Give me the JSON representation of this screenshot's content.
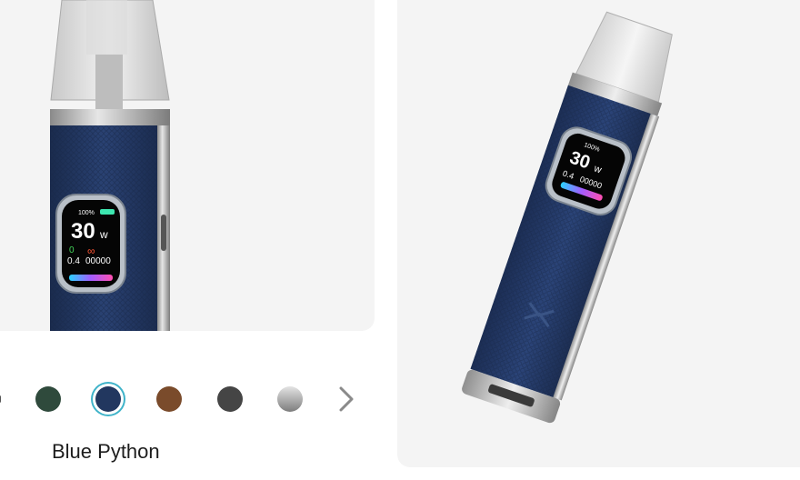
{
  "product": {
    "selected_color_name": "Blue Python"
  },
  "color_swatches": [
    {
      "name": "Green",
      "color": "#2f4a3c",
      "selected": false
    },
    {
      "name": "Blue Python",
      "color": "#22375f",
      "selected": true
    },
    {
      "name": "Brown",
      "color": "#7a4b2b",
      "selected": false
    },
    {
      "name": "Black",
      "color": "#454545",
      "selected": false
    },
    {
      "name": "Silver",
      "color": "#9a9a9a",
      "selected": false
    }
  ],
  "device_screen": {
    "battery": "100%",
    "wattage": "30",
    "wattage_unit": "w",
    "resistance_top": "0",
    "resistance": "0.4",
    "puff_count": "00000",
    "infinity_symbol": "∞"
  },
  "colors": {
    "accent": "#3fb3c9",
    "device_body": "#22375f",
    "panel_bg": "#f4f4f4"
  }
}
